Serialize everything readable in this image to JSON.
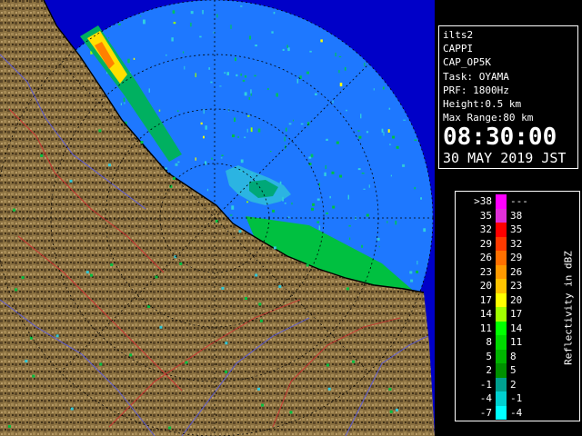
{
  "info": {
    "station": "ilts2",
    "product": "CAPPI",
    "scan": "CAP_OP5K",
    "task": "Task: OYAMA",
    "prf": "PRF: 1800Hz",
    "height": "Height:0.5 km",
    "range": "Max Range:80 km",
    "time": "08:30:00",
    "date": "30 MAY 2019 JST"
  },
  "legend": {
    "title": "Reflectivity in dBZ",
    "rows": [
      {
        "lo": ">38",
        "hi": "---",
        "color": "#ff00ff"
      },
      {
        "lo": "35",
        "hi": "38",
        "color": "#e030d8"
      },
      {
        "lo": "32",
        "hi": "35",
        "color": "#ff0000"
      },
      {
        "lo": "29",
        "hi": "32",
        "color": "#ff3a00"
      },
      {
        "lo": "26",
        "hi": "29",
        "color": "#ff7000"
      },
      {
        "lo": "23",
        "hi": "26",
        "color": "#ff9a00"
      },
      {
        "lo": "20",
        "hi": "23",
        "color": "#ffc400"
      },
      {
        "lo": "17",
        "hi": "20",
        "color": "#ffff00"
      },
      {
        "lo": "14",
        "hi": "17",
        "color": "#a0ff00"
      },
      {
        "lo": "11",
        "hi": "14",
        "color": "#00ff00"
      },
      {
        "lo": "8",
        "hi": "11",
        "color": "#00d800"
      },
      {
        "lo": "5",
        "hi": "8",
        "color": "#00b400"
      },
      {
        "lo": "2",
        "hi": "5",
        "color": "#009000"
      },
      {
        "lo": "-1",
        "hi": "2",
        "color": "#00a090"
      },
      {
        "lo": "-4",
        "hi": "-1",
        "color": "#00d0d0"
      },
      {
        "lo": "-7",
        "hi": "-4",
        "color": "#00ffff"
      }
    ]
  },
  "map": {
    "sea_color": "#0000c8",
    "echo_area_color": "#1e78ff",
    "land_color": "#8a7040"
  }
}
